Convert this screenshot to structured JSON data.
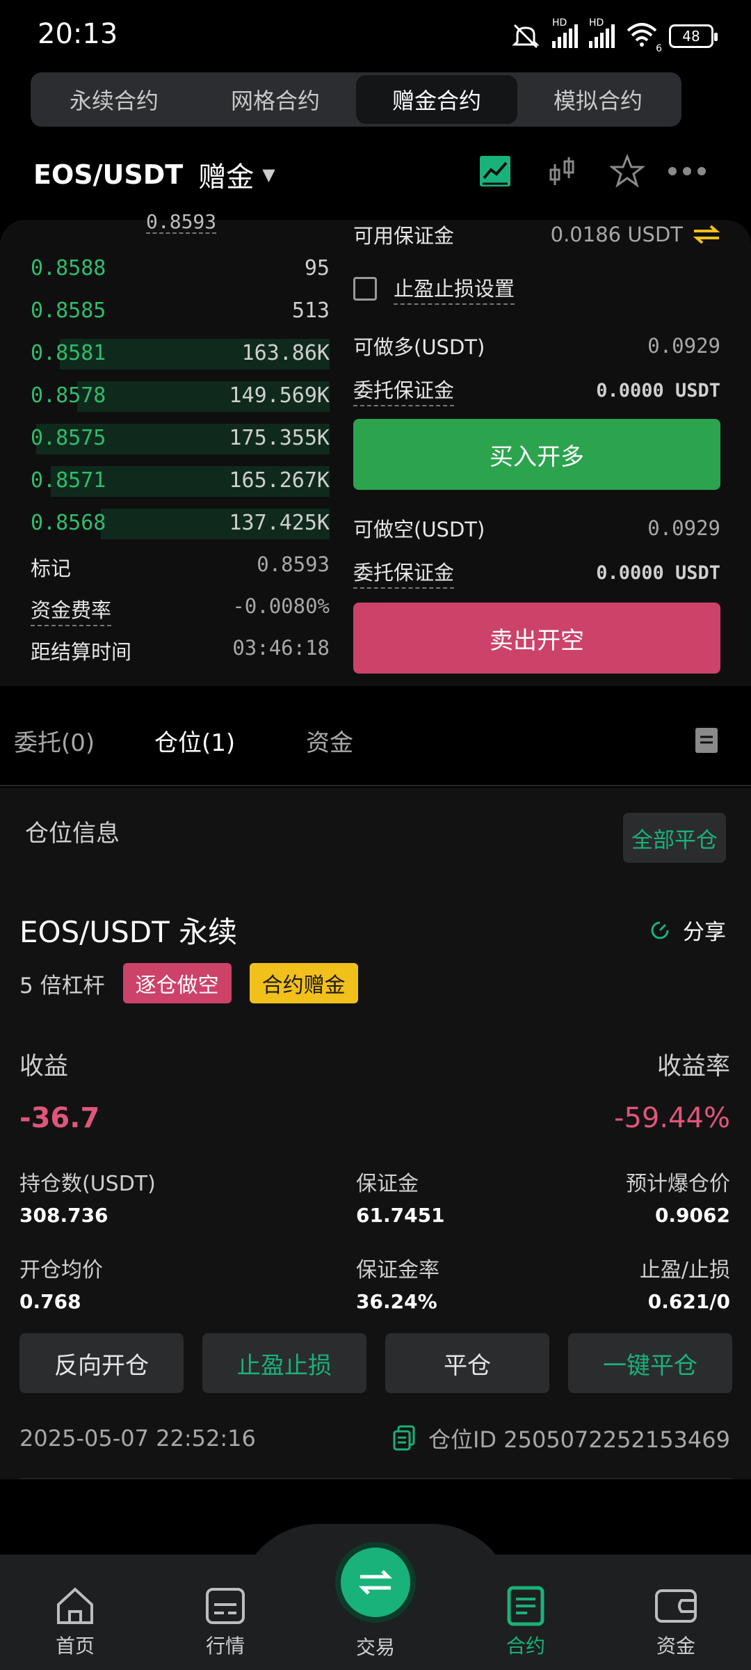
{
  "status_bar": {
    "time": "20:13",
    "battery": "48",
    "net1": "HD",
    "net2": "HD",
    "net2_sub": "6"
  },
  "top_tabs": [
    "永续合约",
    "网格合约",
    "赠金合约",
    "模拟合约"
  ],
  "active_top_tab": 2,
  "pair": {
    "symbol": "EOS/USDT",
    "mode": "赠金",
    "caret": "▼"
  },
  "orderbook": {
    "top_price": "0.8593",
    "rows": [
      {
        "price": "0.8588",
        "qty": "95",
        "depth": 0
      },
      {
        "price": "0.8585",
        "qty": "513",
        "depth": 0
      },
      {
        "price": "0.8581",
        "qty": "163.86K",
        "depth": 0.92
      },
      {
        "price": "0.8578",
        "qty": "149.569K",
        "depth": 0.86
      },
      {
        "price": "0.8575",
        "qty": "175.355K",
        "depth": 1.0
      },
      {
        "price": "0.8571",
        "qty": "165.267K",
        "depth": 0.95
      },
      {
        "price": "0.8568",
        "qty": "137.425K",
        "depth": 0.78
      }
    ]
  },
  "market_info": [
    {
      "label": "标记",
      "value": "0.8593"
    },
    {
      "label": "资金费率",
      "value": "-0.0080%"
    },
    {
      "label": "距结算时间",
      "value": "03:46:18"
    }
  ],
  "order_form": {
    "available_margin_label": "可用保证金",
    "available_margin_value": "0.0186 USDT",
    "tpsl_label": "止盈止损设置",
    "long_max_label": "可做多(USDT)",
    "long_max_value": "0.0929",
    "long_margin_label": "委托保证金",
    "long_margin_value": "0.0000 USDT",
    "buy_button": "买入开多",
    "short_max_label": "可做空(USDT)",
    "short_max_value": "0.0929",
    "short_margin_label": "委托保证金",
    "short_margin_value": "0.0000 USDT",
    "sell_button": "卖出开空"
  },
  "position_tabs": [
    "委托(0)",
    "仓位(1)",
    "资金"
  ],
  "active_position_tab": 1,
  "position": {
    "section_title": "仓位信息",
    "close_all": "全部平仓",
    "symbol": "EOS/USDT 永续",
    "share": "分享",
    "leverage": "5 倍杠杆",
    "tag_side": "逐仓做空",
    "tag_bonus": "合约赠金",
    "pnl_label": "收益",
    "pnl_value": "-36.7",
    "roe_label": "收益率",
    "roe_value": "-59.44%",
    "size_label": "持仓数(USDT)",
    "size_value": "308.736",
    "margin_label": "保证金",
    "margin_value": "61.7451",
    "liq_label": "预计爆仓价",
    "liq_value": "0.9062",
    "entry_label": "开仓均价",
    "entry_value": "0.768",
    "margin_ratio_label": "保证金率",
    "margin_ratio_value": "36.24%",
    "tpsl_label": "止盈/止损",
    "tpsl_value": "0.621/0",
    "actions": [
      "反向开仓",
      "止盈止损",
      "平仓",
      "一键平仓"
    ],
    "time": "2025-05-07 22:52:16",
    "position_id": "仓位ID 2505072252153469"
  },
  "bottom_nav": [
    "首页",
    "行情",
    "交易",
    "合约",
    "资金"
  ],
  "active_nav": 3,
  "colors": {
    "green": "#2fbd6b",
    "buy": "#2ca44e",
    "sell": "#cc4268",
    "red": "#e0567a",
    "yellow": "#f2c01a",
    "accent": "#19b27a"
  }
}
